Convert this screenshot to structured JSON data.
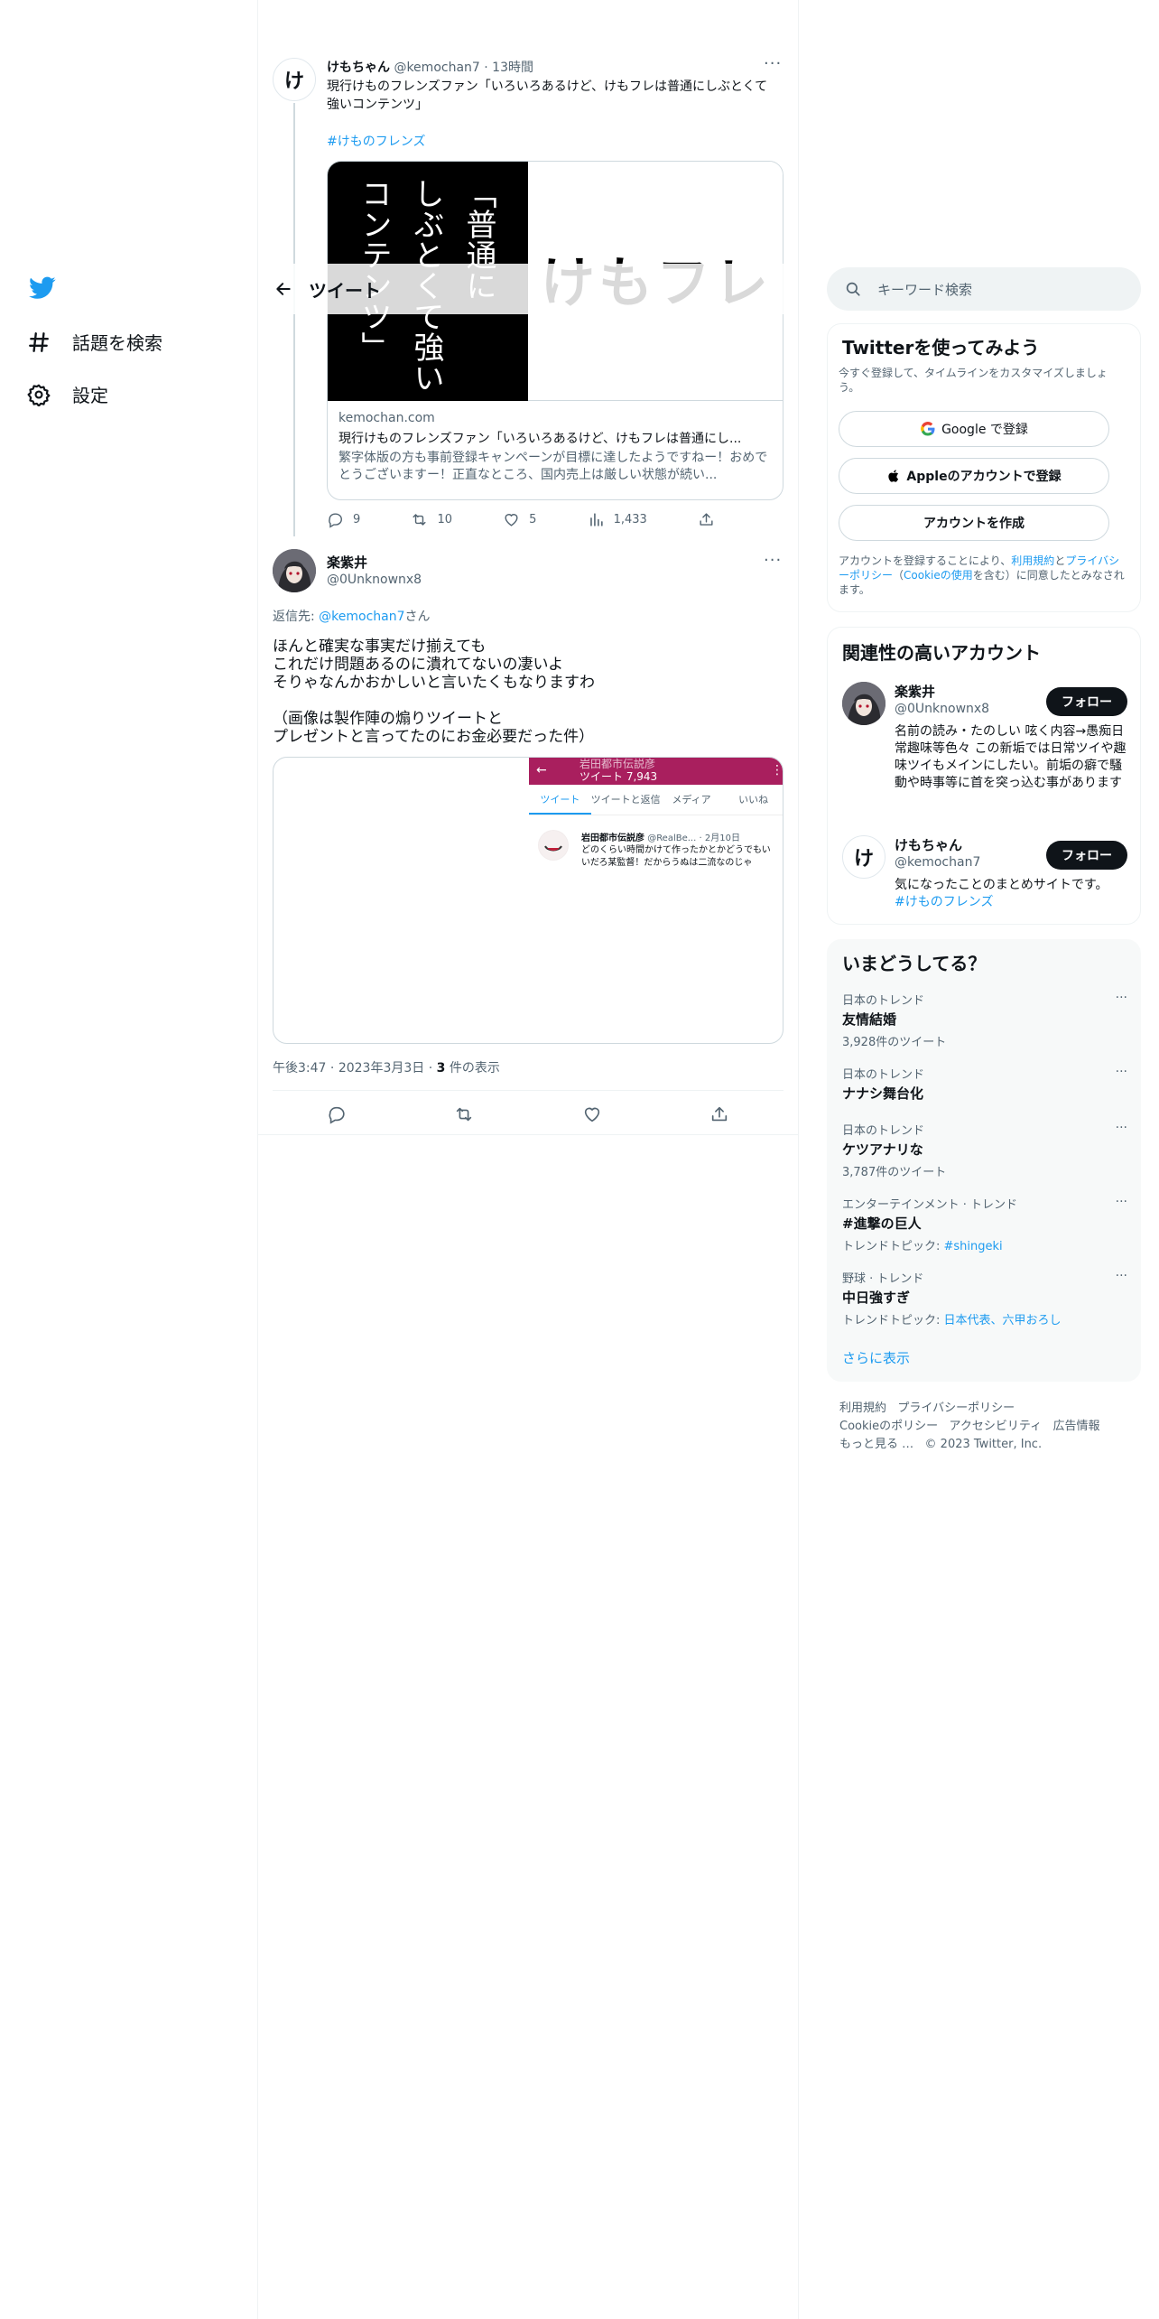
{
  "nav": {
    "explore_label": "話題を検索",
    "settings_label": "設定"
  },
  "header": {
    "title": "ツイート"
  },
  "parent_tweet": {
    "avatar_char": "け",
    "display_name": "けもちゃん",
    "handle": "@kemochan7",
    "time": "13時間",
    "text": "現行けものフレンズファン「いろいろあるけど、けもフレは普通にしぶとくて強いコンテンツ」",
    "hashtag": "#けものフレンズ",
    "card": {
      "image_vertical_lines": [
        "「普通に",
        "しぶとくて強い",
        "コンテンツ」"
      ],
      "image_banner": "けもフレ",
      "domain": "kemochan.com",
      "title": "現行けものフレンズファン「いろいろあるけど、けもフレは普通にし...",
      "description": "繁字体版の方も事前登録キャンペーンが目標に達したようですねー！おめでとうございますー！正直なところ、国内売上は厳しい状態が続い..."
    },
    "stats": {
      "replies": "9",
      "retweets": "10",
      "likes": "5",
      "views": "1,433"
    }
  },
  "main_tweet": {
    "display_name": "楽紫井",
    "handle": "@0Unknownx8",
    "reply_to_prefix": "返信先: ",
    "reply_to_handle": "@kemochan7",
    "reply_to_suffix": "さん",
    "text": "ほんと確実な事実だけ揃えても\nこれだけ問題あるのに潰れてないの凄いよ\nそりゃなんかおかしいと言いたくもなりますわ\n\n（画像は製作陣の煽りツイートと\nプレゼントと言ってたのにお金必要だった件）",
    "media": {
      "profile_name": "岩田都市伝説彦",
      "tweet_count": "ツイート 7,943",
      "tabs": [
        "ツイート",
        "ツイートと返信",
        "メディア",
        "いいね"
      ],
      "inner_name": "岩田都市伝説彦",
      "inner_handle": "@RealBe...",
      "inner_date": "2月10日",
      "inner_text": "どのくらい時間かけて作ったかとかどうでもいいだろ某監督！だからうぬは二流なのじゃ"
    },
    "time": "午後3:47",
    "date": "2023年3月3日",
    "views_count": "3",
    "views_label": " 件の表示"
  },
  "sidebar": {
    "search_placeholder": "キーワード検索",
    "signup": {
      "title": "Twitterを使ってみよう",
      "subtitle": "今すぐ登録して、タイムラインをカスタマイズしましょう。",
      "google_label": "Google で登録",
      "apple_label": "Appleのアカウントで登録",
      "create_label": "アカウントを作成",
      "legal_1": "アカウントを登録することにより、",
      "terms": "利用規約",
      "legal_2": "と",
      "privacy": "プライバシーポリシー",
      "legal_3": "（",
      "cookie": "Cookieの使用",
      "legal_4": "を含む）に同意したとみなされます。"
    },
    "related": {
      "title": "関連性の高いアカウント",
      "accounts": [
        {
          "name": "楽紫井",
          "handle": "@0Unknownx8",
          "bio": "名前の読み・たのしい 呟く内容→愚痴日常趣味等色々 この新垢では日常ツイや趣味ツイもメインにしたい。前垢の癖で騒動や時事等に首を突っ込む事があります",
          "follow_label": "フォロー"
        },
        {
          "avatar_char": "け",
          "name": "けもちゃん",
          "handle": "@kemochan7",
          "bio": "気になったことのまとめサイトです。",
          "bio_tag": "#けものフレンズ",
          "follow_label": "フォロー"
        }
      ]
    },
    "trends": {
      "title": "いまどうしてる？",
      "items": [
        {
          "meta": "日本のトレンド",
          "name": "友情結婚",
          "sub": "3,928件のツイート",
          "sub_link": ""
        },
        {
          "meta": "日本のトレンド",
          "name": "ナナシ舞台化",
          "sub": "",
          "sub_link": ""
        },
        {
          "meta": "日本のトレンド",
          "name": "ケツアナリな",
          "sub": "3,787件のツイート",
          "sub_link": ""
        },
        {
          "meta": "エンターテインメント · トレンド",
          "name": "#進撃の巨人",
          "sub": "トレンドトピック: ",
          "sub_link": "#shingeki"
        },
        {
          "meta": "野球 · トレンド",
          "name": "中日強すぎ",
          "sub": "トレンドトピック: ",
          "sub_link": "日本代表、六甲おろし"
        }
      ],
      "show_more": "さらに表示"
    },
    "footer": {
      "line1": [
        "利用規約",
        "プライバシーポリシー"
      ],
      "line2": [
        "Cookieのポリシー",
        "アクセシビリティ",
        "広告情報"
      ],
      "more": "もっと見る …",
      "copyright": "© 2023 Twitter, Inc."
    }
  },
  "colors": {
    "accent": "#1d9bf0",
    "text": "#0f1419",
    "muted": "#536471",
    "border": "#eff3f4",
    "profile_bar": "#a91f5e"
  }
}
